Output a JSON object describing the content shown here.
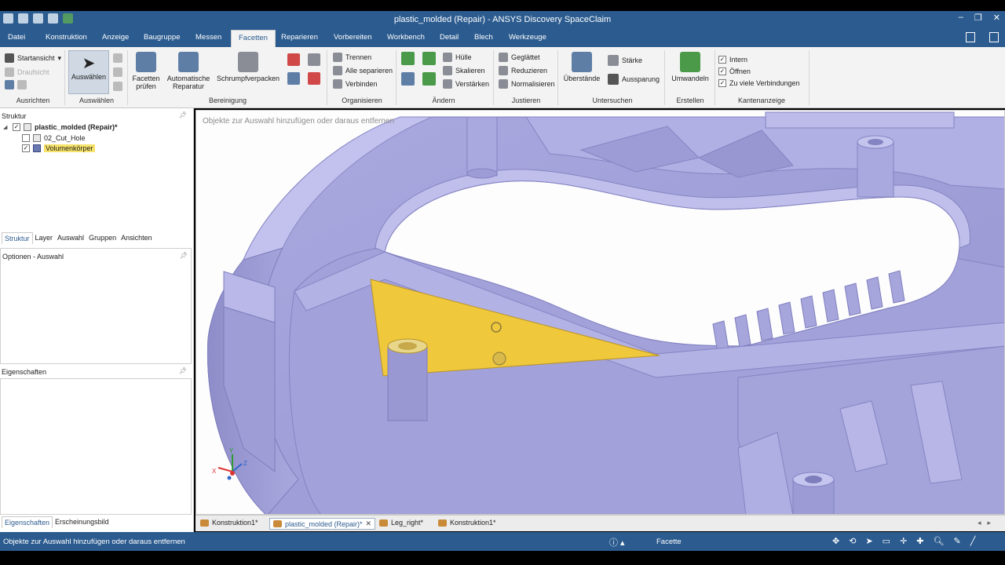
{
  "window": {
    "title": "plastic_molded (Repair) - ANSYS Discovery SpaceClaim",
    "controls": [
      "–",
      "❐",
      "✕"
    ]
  },
  "tabs": [
    "Datei",
    "Konstruktion",
    "Anzeige",
    "Baugruppe",
    "Messen",
    "Facetten",
    "Reparieren",
    "Vorbereiten",
    "Workbench",
    "Detail",
    "Blech",
    "Werkzeuge"
  ],
  "ribbon": {
    "ausrichten": {
      "title": "Ausrichten",
      "startansicht": "Startansicht",
      "draufsicht": "Draufsicht"
    },
    "auswaehlen": {
      "title": "Auswählen",
      "button": "Auswählen"
    },
    "bereinigung": {
      "title": "Bereinigung",
      "facetten_pruefen": "Facetten prüfen",
      "auto_reparatur": "Automatische Reparatur",
      "schrumpf": "Schrumpfverpacken"
    },
    "organisieren": {
      "title": "Organisieren",
      "trennen": "Trennen",
      "alle_separieren": "Alle separieren",
      "verbinden": "Verbinden"
    },
    "aendern": {
      "title": "Ändern",
      "huelle": "Hülle",
      "skalieren": "Skalieren",
      "verstaerken": "Verstärken"
    },
    "justieren": {
      "title": "Justieren",
      "geglaettet": "Geglättet",
      "reduzieren": "Reduzieren",
      "normalisieren": "Normalisieren"
    },
    "untersuchen": {
      "title": "Untersuchen",
      "ueberstaende": "Überstände",
      "staerke": "Stärke",
      "aussparung": "Aussparung"
    },
    "erstellen": {
      "title": "Erstellen",
      "umwandeln": "Umwandeln"
    },
    "kantenanzeige": {
      "title": "Kantenanzeige",
      "intern": "Intern",
      "oeffnen": "Öffnen",
      "zu_viele": "Zu viele Verbindungen"
    }
  },
  "structure": {
    "header": "Struktur",
    "root": "plastic_molded (Repair)*",
    "children": [
      "02_Cut_Hole",
      "Volumenkörper"
    ],
    "tabs": [
      "Struktur",
      "Layer",
      "Auswahl",
      "Gruppen",
      "Ansichten"
    ]
  },
  "options": {
    "header": "Optionen - Auswahl"
  },
  "properties": {
    "header": "Eigenschaften",
    "tabs": [
      "Eigenschaften",
      "Erscheinungsbild"
    ]
  },
  "viewport": {
    "hint": "Objekte zur Auswahl hinzufügen oder daraus entfernen",
    "triad": {
      "x": "X",
      "y": "Y",
      "z": "Z"
    }
  },
  "doc_tabs": [
    {
      "label": "Konstruktion1*",
      "active": false,
      "closable": false
    },
    {
      "label": "plastic_molded (Repair)*",
      "active": true,
      "closable": true
    },
    {
      "label": "Leg_right*",
      "active": false,
      "closable": false
    },
    {
      "label": "Konstruktion1*",
      "active": false,
      "closable": false
    }
  ],
  "status": {
    "message": "Objekte zur Auswahl hinzufügen oder daraus entfernen",
    "mode": "Facette"
  },
  "colors": {
    "accent": "#2b5b8f",
    "model": "#a7a6de",
    "selection": "#f0c83c"
  }
}
